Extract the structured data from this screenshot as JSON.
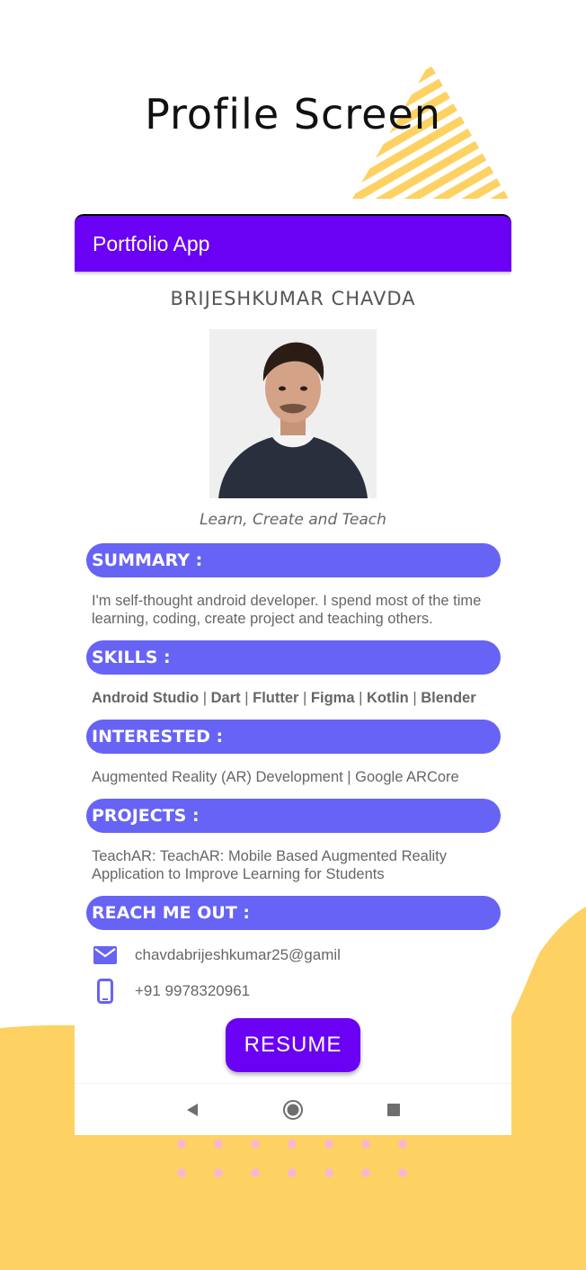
{
  "poster": {
    "title": "Profile Screen"
  },
  "appbar": {
    "title": "Portfolio App"
  },
  "profile": {
    "name": "BRIJESHKUMAR CHAVDA",
    "tagline": "Learn, Create and Teach"
  },
  "sections": {
    "summary": {
      "header": "SUMMARY :",
      "body": "I'm self-thought android developer. I spend most of the time learning, coding, create project and teaching others."
    },
    "skills": {
      "header": "SKILLS :",
      "items": [
        "Android Studio",
        "Dart",
        "Flutter",
        "Figma",
        "Kotlin",
        "Blender"
      ],
      "separator": " | "
    },
    "interested": {
      "header": "INTERESTED :",
      "body": "Augmented Reality (AR) Development | Google ARCore"
    },
    "projects": {
      "header": "PROJECTS :",
      "body": "TeachAR: TeachAR: Mobile Based Augmented Reality Application to Improve Learning for Students"
    },
    "reach": {
      "header": "REACH ME OUT :",
      "email": "chavdabrijeshkumar25@gamil",
      "phone": "+91 9978320961"
    }
  },
  "resume_button": {
    "label": "RESUME"
  },
  "colors": {
    "primary": "#6a00f4",
    "section_header": "#6763f5",
    "accent_yellow": "#fdd263",
    "dots_pink": "#f7b8cf"
  },
  "navbar": {
    "icons": [
      "back-icon",
      "home-icon",
      "recents-icon"
    ]
  }
}
